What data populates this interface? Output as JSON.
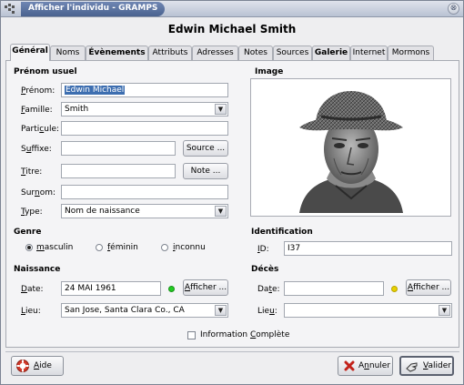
{
  "window": {
    "title": "Afficher l'individu - GRAMPS",
    "close_glyph": "⊗"
  },
  "person_name": "Edwin Michael Smith",
  "tabs": [
    {
      "label": "Général",
      "active": true
    },
    {
      "label": "Noms"
    },
    {
      "label": "Évènements",
      "bold": true
    },
    {
      "label": "Attributs"
    },
    {
      "label": "Adresses"
    },
    {
      "label": "Notes"
    },
    {
      "label": "Sources"
    },
    {
      "label": "Galerie",
      "bold": true
    },
    {
      "label": "Internet"
    },
    {
      "label": "Mormons"
    }
  ],
  "preferred_name": {
    "section_title": "Prénom usuel",
    "given_label_pre": "",
    "given_label_key": "P",
    "given_label_post": "rénom:",
    "given_value": "Edwin Michael",
    "family_label_key": "F",
    "family_label_post": "amille:",
    "family_value": "Smith",
    "particle_label_pre": "Parti",
    "particle_label_key": "c",
    "particle_label_post": "ule:",
    "particle_value": "",
    "suffix_label_pre": "S",
    "suffix_label_key": "u",
    "suffix_label_post": "ffixe:",
    "suffix_value": "",
    "source_button": "Source ...",
    "title_label_key": "T",
    "title_label_post": "itre:",
    "title_value": "",
    "note_button": "Note ...",
    "nick_label_pre": "Sur",
    "nick_label_key": "n",
    "nick_label_post": "om:",
    "nick_value": "",
    "type_label_key": "T",
    "type_label_post": "ype:",
    "type_value": "Nom de naissance"
  },
  "image": {
    "section_title": "Image"
  },
  "gender": {
    "section_title": "Genre",
    "options": [
      {
        "pre": "",
        "key": "m",
        "post": "asculin",
        "checked": true
      },
      {
        "pre": "",
        "key": "f",
        "post": "éminin",
        "checked": false
      },
      {
        "pre": "",
        "key": "i",
        "post": "nconnu",
        "checked": false
      }
    ]
  },
  "identification": {
    "section_title": "Identification",
    "id_label_key": "I",
    "id_label_post": "D:",
    "id_value": "I37"
  },
  "birth": {
    "section_title": "Naissance",
    "date_label_key": "D",
    "date_label_post": "ate:",
    "date_value": "24 MAI 1961",
    "status_color": "#22cc22",
    "show_button_key": "A",
    "show_button_post": "fficher ...",
    "place_label_key": "L",
    "place_label_post": "ieu:",
    "place_value": "San Jose, Santa Clara Co., CA"
  },
  "death": {
    "section_title": "Décès",
    "date_label_pre": "Da",
    "date_label_key": "t",
    "date_label_post": "e:",
    "date_value": "",
    "status_color": "#e8d000",
    "show_button_key": "A",
    "show_button_post": "fficher ...",
    "place_label_pre": "Lie",
    "place_label_key": "u",
    "place_label_post": ":",
    "place_value": ""
  },
  "complete": {
    "label_pre": "Information ",
    "label_key": "C",
    "label_post": "omplète",
    "checked": false
  },
  "footer": {
    "help_key": "A",
    "help_post": "ide",
    "cancel_pre": "A",
    "cancel_key": "n",
    "cancel_post": "nuler",
    "ok_key": "V",
    "ok_post": "alider"
  }
}
